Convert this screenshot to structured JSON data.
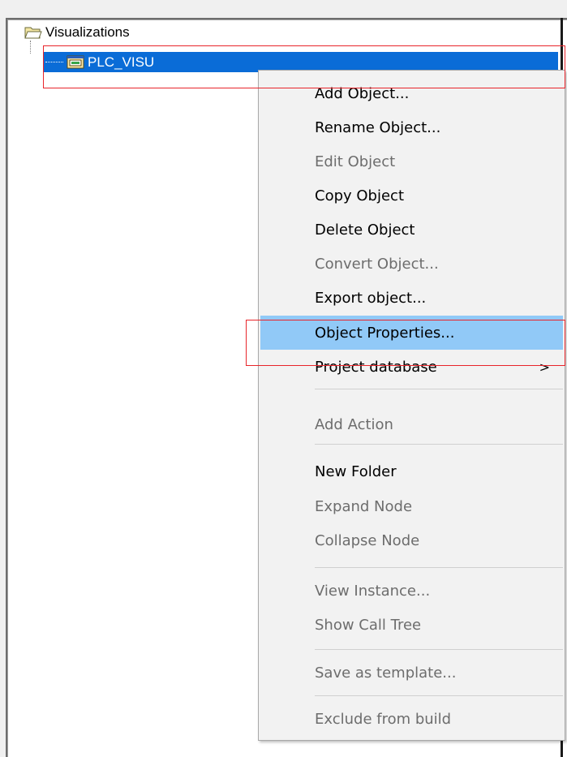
{
  "tree": {
    "root": {
      "label": "Visualizations",
      "icon": "folder-open-icon"
    },
    "selected_child": {
      "label": "PLC_VISU",
      "icon": "visualization-icon"
    }
  },
  "context_menu": {
    "items": [
      {
        "label": "Add Object...",
        "enabled": true
      },
      {
        "label": "Rename Object...",
        "enabled": true
      },
      {
        "label": "Edit Object",
        "enabled": false
      },
      {
        "label": "Copy Object",
        "enabled": true
      },
      {
        "label": "Delete Object",
        "enabled": true
      },
      {
        "label": "Convert Object...",
        "enabled": false
      },
      {
        "label": "Export object...",
        "enabled": true
      },
      {
        "label": "Object Properties...",
        "enabled": true,
        "highlighted": true
      },
      {
        "label": "Project database",
        "enabled": true,
        "submenu_arrow": ">"
      },
      {
        "label": "Add Action",
        "enabled": false
      },
      {
        "label": "New Folder",
        "enabled": true
      },
      {
        "label": "Expand Node",
        "enabled": false
      },
      {
        "label": "Collapse Node",
        "enabled": false
      },
      {
        "label": "View Instance...",
        "enabled": false
      },
      {
        "label": "Show Call Tree",
        "enabled": false
      },
      {
        "label": "Save as template...",
        "enabled": false
      },
      {
        "label": "Exclude from build",
        "enabled": false
      }
    ]
  },
  "colors": {
    "selection_blue": "#0a6cd7",
    "menu_hover": "#91c9f7",
    "annotation_red": "#e8252b",
    "disabled_text": "#6d6d6d"
  }
}
